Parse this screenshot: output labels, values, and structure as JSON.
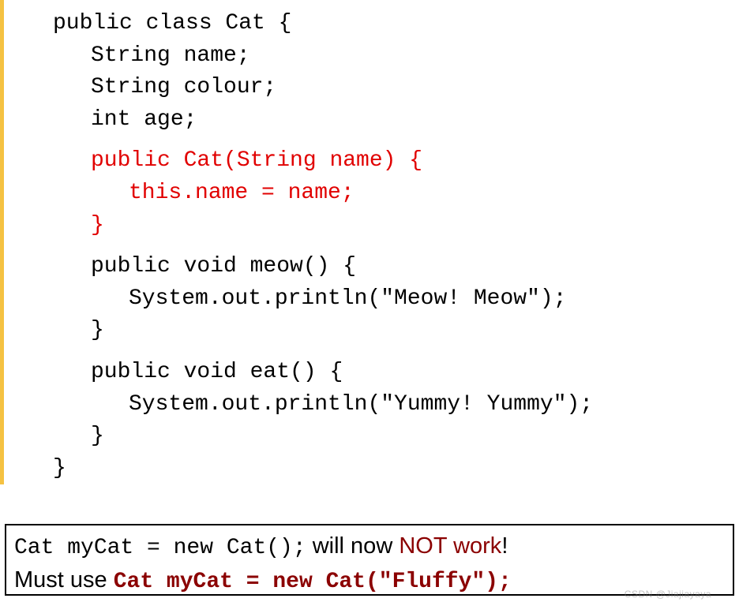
{
  "code": {
    "l1": "public class Cat {",
    "l2": "String name;",
    "l3": "String colour;",
    "l4": "int age;",
    "l5": "public Cat(String name) {",
    "l6": "this.name = name;",
    "l7": "}",
    "l8": "public void meow() {",
    "l9": "System.out.println(\"Meow! Meow\");",
    "l10": "}",
    "l11": "public void eat() {",
    "l12": "System.out.println(\"Yummy! Yummy\");",
    "l13": "}",
    "l14": "}"
  },
  "bottom": {
    "line1_code": "Cat myCat = new Cat();",
    "line1_text1": " will now ",
    "line1_highlight": "NOT work",
    "line1_end": "!",
    "line2_text": "Must use ",
    "line2_code": "Cat myCat = new Cat(\"Fluffy\");"
  },
  "watermark": "CSDN @Jiajiayaya"
}
